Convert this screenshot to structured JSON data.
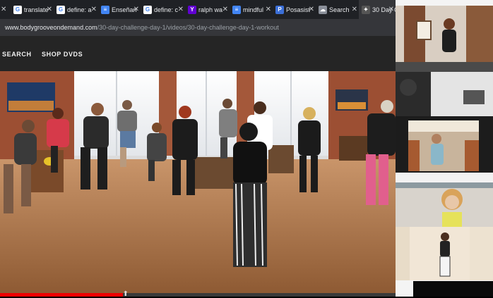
{
  "browser": {
    "tabs": [
      {
        "title": "",
        "icon": "close-icon",
        "favicon_color": "#1f2125",
        "favicon_glyph": ""
      },
      {
        "title": "translate",
        "icon": "google-favicon-icon",
        "favicon_color": "#ffffff",
        "favicon_glyph": "G"
      },
      {
        "title": "define: a",
        "icon": "google-favicon-icon",
        "favicon_color": "#ffffff",
        "favicon_glyph": "G"
      },
      {
        "title": "Enseñan",
        "icon": "docs-favicon-icon",
        "favicon_color": "#4285f4",
        "favicon_glyph": "≡"
      },
      {
        "title": "define: c",
        "icon": "google-favicon-icon",
        "favicon_color": "#ffffff",
        "favicon_glyph": "G"
      },
      {
        "title": "ralph wa",
        "icon": "yahoo-favicon-icon",
        "favicon_color": "#6001d2",
        "favicon_glyph": "Y"
      },
      {
        "title": "mindful",
        "icon": "docs-favicon-icon",
        "favicon_color": "#4285f4",
        "favicon_glyph": "≡"
      },
      {
        "title": "Posasist",
        "icon": "blue-favicon-icon",
        "favicon_color": "#3b6fd8",
        "favicon_glyph": "P"
      },
      {
        "title": "Search",
        "icon": "cloud-favicon-icon",
        "favicon_color": "#8a8f99",
        "favicon_glyph": "☁"
      },
      {
        "title": "30 Day C",
        "icon": "site-favicon-icon",
        "favicon_color": "#555555",
        "favicon_glyph": "✦"
      }
    ],
    "url_host": "www.bodygrooveondemand.com",
    "url_path": "/30-day-challenge-day-1/videos/30-day-challenge-day-1-workout"
  },
  "site_nav": {
    "search_label": "SEARCH",
    "shop_label": "SHOP DVDS"
  },
  "video": {
    "progress_fraction": 0.31
  },
  "colors": {
    "tabbar": "#1f2125",
    "addressbar": "#35363a",
    "nav_bg": "#252525",
    "progress": "#ee0000",
    "floor": "#b07a4c",
    "brick": "#9c4f33"
  }
}
